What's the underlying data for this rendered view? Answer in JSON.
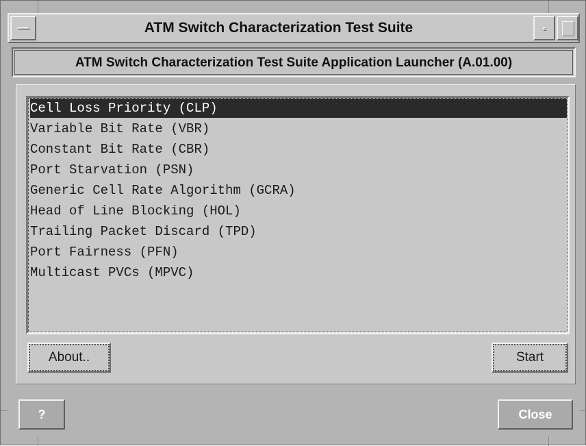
{
  "window": {
    "title": "ATM Switch Characterization Test Suite"
  },
  "header": {
    "title": "ATM Switch Characterization Test Suite Application Launcher (A.01.00)"
  },
  "tests": {
    "items": [
      {
        "label": "Cell Loss Priority (CLP)",
        "selected": true
      },
      {
        "label": "Variable Bit Rate (VBR)",
        "selected": false
      },
      {
        "label": "Constant Bit Rate (CBR)",
        "selected": false
      },
      {
        "label": "Port Starvation (PSN)",
        "selected": false
      },
      {
        "label": "Generic Cell Rate Algorithm (GCRA)",
        "selected": false
      },
      {
        "label": "Head of Line Blocking (HOL)",
        "selected": false
      },
      {
        "label": "Trailing Packet Discard (TPD)",
        "selected": false
      },
      {
        "label": "Port Fairness (PFN)",
        "selected": false
      },
      {
        "label": "Multicast PVCs (MPVC)",
        "selected": false
      }
    ]
  },
  "buttons": {
    "about": "About..",
    "start": "Start",
    "help": "?",
    "close": "Close"
  },
  "colors": {
    "window_bg": "#b4b4b4",
    "panel_bg": "#c8c8c8",
    "selection_bg": "#2a2a2a",
    "selection_fg": "#ffffff"
  }
}
